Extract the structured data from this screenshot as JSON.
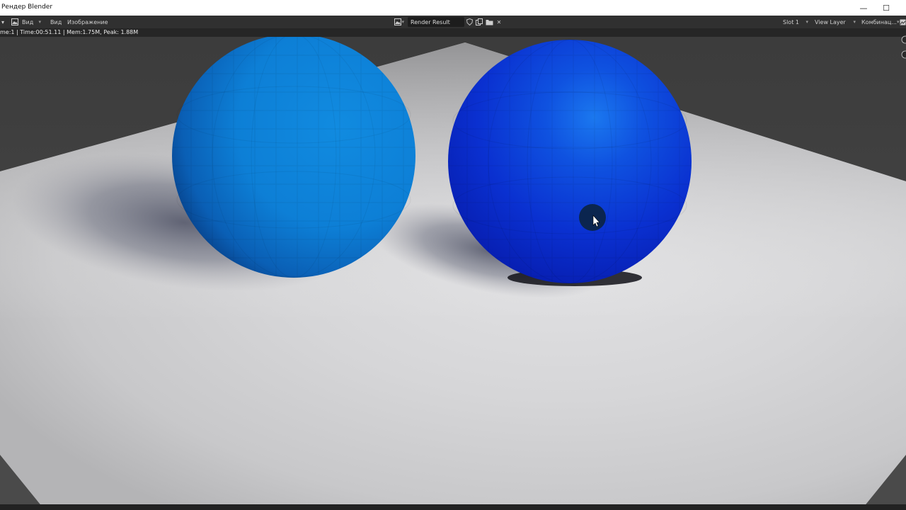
{
  "window": {
    "title": "Рендер Blender",
    "minimize_glyph": "—",
    "maximize_glyph": "☐"
  },
  "header": {
    "view_dropdown": "Вид",
    "view_menu": "Вид",
    "image_menu": "Изображение",
    "image_name": "Render Result",
    "slot": "Slot 1",
    "view_layer": "View Layer",
    "pass": "Комбинац..."
  },
  "status": {
    "text": "me:1 | Time:00:51.11 | Mem:1.75M, Peak: 1.88M"
  },
  "icons": {
    "editor_type": "image-editor-icon",
    "image_browse": "image-browse-icon",
    "fake_user": "shield-icon",
    "new_image": "duplicate-icon",
    "open_image": "folder-icon",
    "unlink": "close-icon",
    "display_channels": "display-channels-icon"
  },
  "colors": {
    "sphere_left": "#0e8ad6",
    "sphere_right": "#0a2fd0",
    "floor": "#d2d2d2",
    "background": "#3a3a3a",
    "header_bg": "#303030"
  }
}
